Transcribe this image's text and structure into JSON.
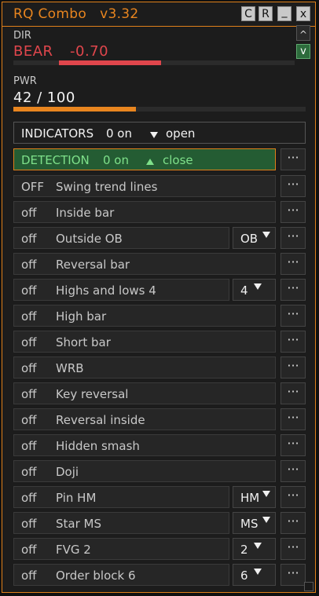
{
  "title": "RQ Combo   v3.32",
  "titlebar_buttons": [
    "C",
    "R",
    "_",
    "x"
  ],
  "side_buttons": {
    "up": "^",
    "down": "v"
  },
  "dir": {
    "label": "DIR",
    "signal": "BEAR",
    "value": "-0.70",
    "bar_fraction": 0.7
  },
  "pwr": {
    "label": "PWR",
    "value": "42 / 100",
    "bar_fraction": 0.42
  },
  "colors": {
    "accent": "#e8851f",
    "bear": "#e0464c",
    "detection_bg": "#245c33",
    "detection_text": "#7ee08a"
  },
  "indicators": {
    "label": "INDICATORS",
    "count": "0 on",
    "action": "open"
  },
  "detection": {
    "label": "DETECTION",
    "count": "0 on",
    "action": "close"
  },
  "more_label": "···",
  "rows": [
    {
      "state": "OFF",
      "name": "Swing trend lines",
      "select": null
    },
    {
      "state": "off",
      "name": "Inside bar",
      "select": null
    },
    {
      "state": "off",
      "name": "Outside OB",
      "select": "OB"
    },
    {
      "state": "off",
      "name": "Reversal bar",
      "select": null
    },
    {
      "state": "off",
      "name": "Highs and lows 4",
      "select": "4"
    },
    {
      "state": "off",
      "name": "High bar",
      "select": null
    },
    {
      "state": "off",
      "name": "Short bar",
      "select": null
    },
    {
      "state": "off",
      "name": "WRB",
      "select": null
    },
    {
      "state": "off",
      "name": "Key reversal",
      "select": null
    },
    {
      "state": "off",
      "name": "Reversal inside",
      "select": null
    },
    {
      "state": "off",
      "name": "Hidden smash",
      "select": null
    },
    {
      "state": "off",
      "name": "Doji",
      "select": null
    },
    {
      "state": "off",
      "name": "Pin HM",
      "select": "HM"
    },
    {
      "state": "off",
      "name": "Star MS",
      "select": "MS"
    },
    {
      "state": "off",
      "name": "FVG 2",
      "select": "2"
    },
    {
      "state": "off",
      "name": "Order block 6",
      "select": "6"
    }
  ]
}
